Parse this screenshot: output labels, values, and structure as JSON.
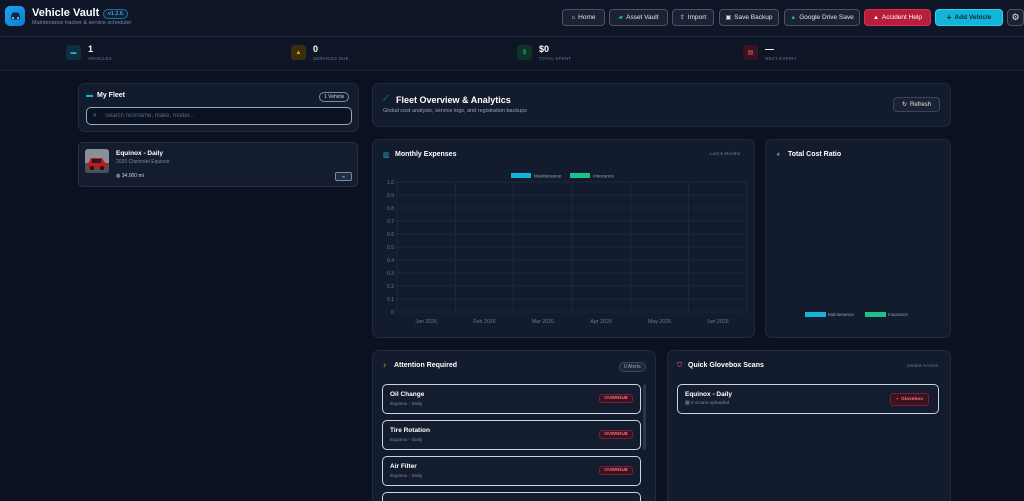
{
  "header": {
    "title": "Vehicle Vault",
    "version": "v1.2.6",
    "subtitle": "Maintenance tracker & service scheduler",
    "buttons": {
      "home": "Home",
      "asset_vault": "Asset Vault",
      "import": "Import",
      "save_backup": "Save Backup",
      "google_drive": "Google Drive Save",
      "accident_help": "Accident Help",
      "add_vehicle": "Add Vehicle"
    }
  },
  "stats": [
    {
      "value": "1",
      "label": "VEHICLES",
      "color": "#12b5d8"
    },
    {
      "value": "0",
      "label": "SERVICES DUE",
      "color": "#f5b300"
    },
    {
      "value": "$0",
      "label": "TOTAL SPENT",
      "color": "#19c48a"
    },
    {
      "value": "—",
      "label": "NEXT EXPIRY",
      "color": "#ff5a72"
    }
  ],
  "fleet": {
    "title": "My Fleet",
    "count_badge": "1 Vehicle",
    "search_placeholder": "Search nickname, make, model...",
    "vehicles": [
      {
        "name": "Equinox - Daily",
        "model": "2020 Chevrolet Equinox",
        "mileage": "34,000 mi"
      }
    ]
  },
  "overview": {
    "title": "Fleet Overview & Analytics",
    "subtitle": "Global cost analysis, service logs, and registration backups",
    "refresh_label": "Refresh"
  },
  "monthly_expenses": {
    "title": "Monthly Expenses",
    "range_label": "Last 6 Months"
  },
  "chart_data": {
    "type": "bar",
    "categories": [
      "Jan 2026",
      "Feb 2026",
      "Mar 2026",
      "Apr 2026",
      "May 2026",
      "Jun 2026"
    ],
    "series": [
      {
        "name": "Maintenance",
        "values": [
          0,
          0,
          0,
          0,
          0,
          0
        ],
        "color": "#12b5d8"
      },
      {
        "name": "Insurance",
        "values": [
          0,
          0,
          0,
          0,
          0,
          0
        ],
        "color": "#19c48a"
      }
    ],
    "yticks": [
      "1.0",
      "0.9",
      "0.8",
      "0.7",
      "0.6",
      "0.5",
      "0.4",
      "0.3",
      "0.2",
      "0.1",
      "0"
    ],
    "ylim": [
      0,
      1.0
    ],
    "grid": true,
    "legend": "top"
  },
  "cost_ratio": {
    "title": "Total Cost Ratio",
    "legend": [
      {
        "name": "Maintenance",
        "color": "#12b5d8"
      },
      {
        "name": "Insurance",
        "color": "#19c48a"
      }
    ]
  },
  "attention": {
    "title": "Attention Required",
    "badge": "0 Alerts",
    "items": [
      {
        "name": "Oil Change",
        "vehicle": "Equinox - Daily",
        "status": "OVERDUE"
      },
      {
        "name": "Tire Rotation",
        "vehicle": "Equinox - Daily",
        "status": "OVERDUE"
      },
      {
        "name": "Air Filter",
        "vehicle": "Equinox - Daily",
        "status": "OVERDUE"
      }
    ]
  },
  "glovebox": {
    "title": "Quick Glovebox Scans",
    "right_label": "Instant Access",
    "items": [
      {
        "name": "Equinox - Daily",
        "scans": "0 Scans uploaded",
        "button": "Glovebox"
      }
    ]
  }
}
